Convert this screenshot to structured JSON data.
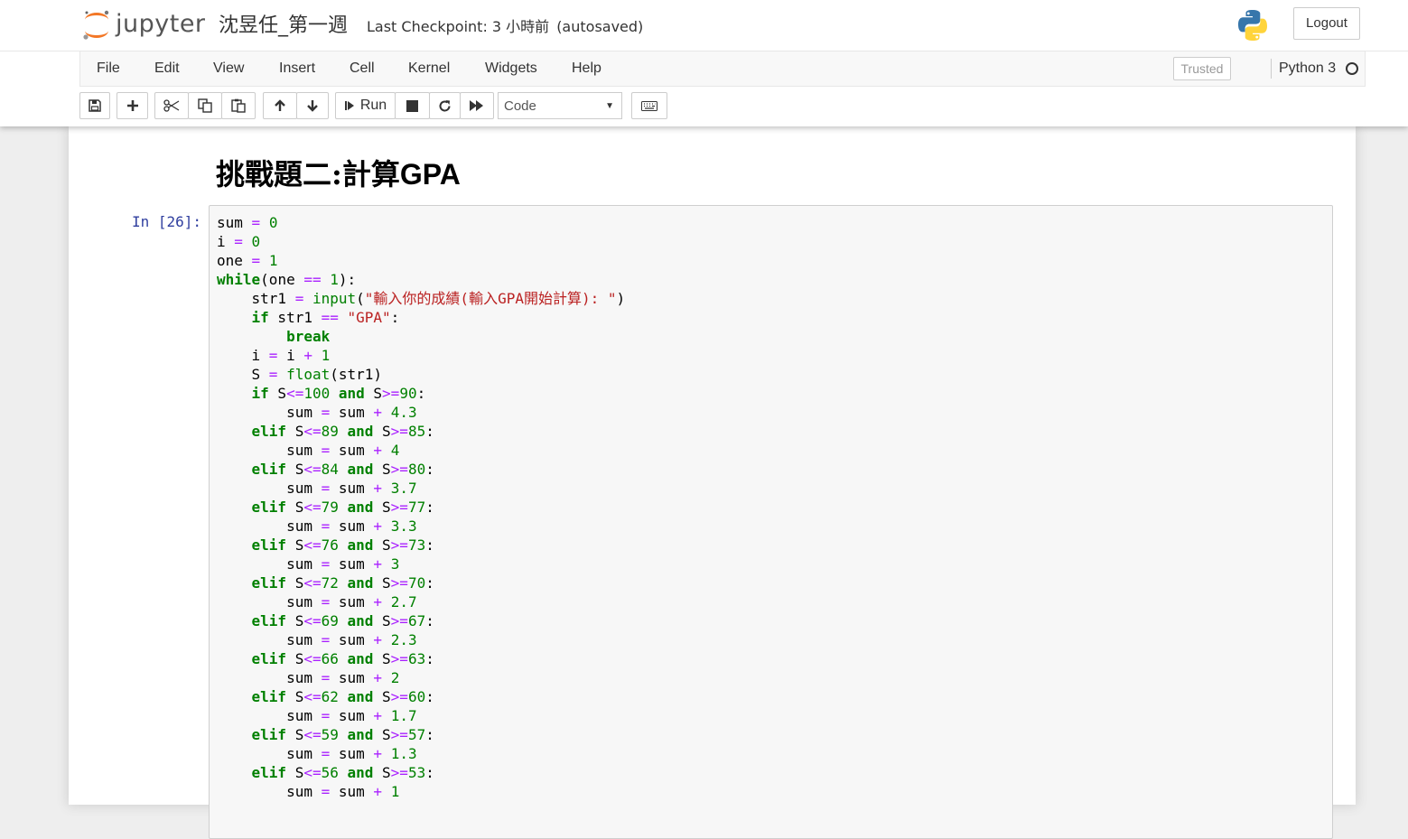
{
  "header": {
    "logo_text": "jupyter",
    "notebook_name": "沈昱任_第一週",
    "checkpoint": "Last Checkpoint: 3 小時前",
    "autosaved": "(autosaved)",
    "logout_label": "Logout"
  },
  "menu": {
    "items": [
      "File",
      "Edit",
      "View",
      "Insert",
      "Cell",
      "Kernel",
      "Widgets",
      "Help"
    ],
    "trusted": "Trusted",
    "kernel_name": "Python 3"
  },
  "toolbar": {
    "run_label": "Run",
    "cell_type": "Code",
    "icons": [
      "save-icon",
      "plus-icon",
      "cut-icon",
      "copy-icon",
      "paste-icon",
      "arrow-up-icon",
      "arrow-down-icon",
      "step-forward-icon",
      "stop-icon",
      "refresh-icon",
      "fast-forward-icon",
      "keyboard-icon"
    ]
  },
  "cells": {
    "markdown_heading_cn": "挑戰題二:計算",
    "markdown_heading_latin": "GPA",
    "prompt": "In [26]:",
    "code_lines": [
      "sum = 0",
      "i = 0",
      "one = 1",
      "while(one == 1):",
      "    str1 = input(\"輸入你的成績(輸入GPA開始計算): \")",
      "    if str1 == \"GPA\":",
      "        break",
      "    i = i + 1",
      "    S = float(str1)",
      "    if S<=100 and S>=90:",
      "        sum = sum + 4.3",
      "    elif S<=89 and S>=85:",
      "        sum = sum + 4",
      "    elif S<=84 and S>=80:",
      "        sum = sum + 3.7",
      "    elif S<=79 and S>=77:",
      "        sum = sum + 3.3",
      "    elif S<=76 and S>=73:",
      "        sum = sum + 3",
      "    elif S<=72 and S>=70:",
      "        sum = sum + 2.7",
      "    elif S<=69 and S>=67:",
      "        sum = sum + 2.3",
      "    elif S<=66 and S>=63:",
      "        sum = sum + 2",
      "    elif S<=62 and S>=60:",
      "        sum = sum + 1.7",
      "    elif S<=59 and S>=57:",
      "        sum = sum + 1.3",
      "    elif S<=56 and S>=53:",
      "        sum = sum + 1"
    ]
  }
}
